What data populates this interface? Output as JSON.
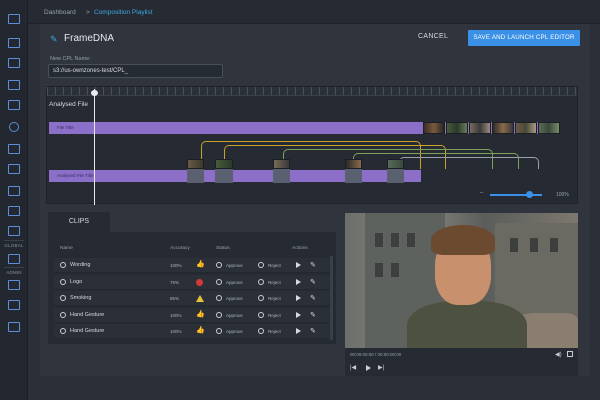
{
  "breadcrumb": {
    "root": "Dashboard",
    "separator": ">",
    "current": "Composition Playlist"
  },
  "header": {
    "title": "FrameDNA",
    "cancel_label": "CANCEL",
    "primary_label": "SAVE AND LAUNCH CPL EDITOR"
  },
  "cpl": {
    "label": "New CPL Name:",
    "value": "s3://us-ownzones-test/CPL_"
  },
  "timeline": {
    "section_label": "Analysed File",
    "track1_label": "File Title",
    "track2_label": "Analysed File Title",
    "zoom_label": "100%",
    "zoom_level": 0.75
  },
  "sidebar": {
    "global_label": "GLOBAL",
    "admin_label": "ADMIN"
  },
  "clips": {
    "tab_label": "CLIPS",
    "columns": {
      "name": "Name",
      "accuracy": "Accuracy",
      "status": "Status",
      "actions": "Actions"
    },
    "approve_label": "Approve",
    "reject_label": "Reject",
    "rows": [
      {
        "name": "Wording",
        "accuracy": "100%",
        "status": "thumbs-up"
      },
      {
        "name": "Logo",
        "accuracy": "75%",
        "status": "stop"
      },
      {
        "name": "Smoking",
        "accuracy": "85%",
        "status": "warning"
      },
      {
        "name": "Hand Gesture",
        "accuracy": "100%",
        "status": "thumbs-up"
      },
      {
        "name": "Hand Gesture",
        "accuracy": "100%",
        "status": "thumbs-up"
      }
    ]
  },
  "video": {
    "timecode": "00:00:00:00 / 00:00:00:00"
  },
  "colors": {
    "accent": "#3a8fe6",
    "track": "#8b6fc9",
    "link": "#3fa6e0"
  }
}
